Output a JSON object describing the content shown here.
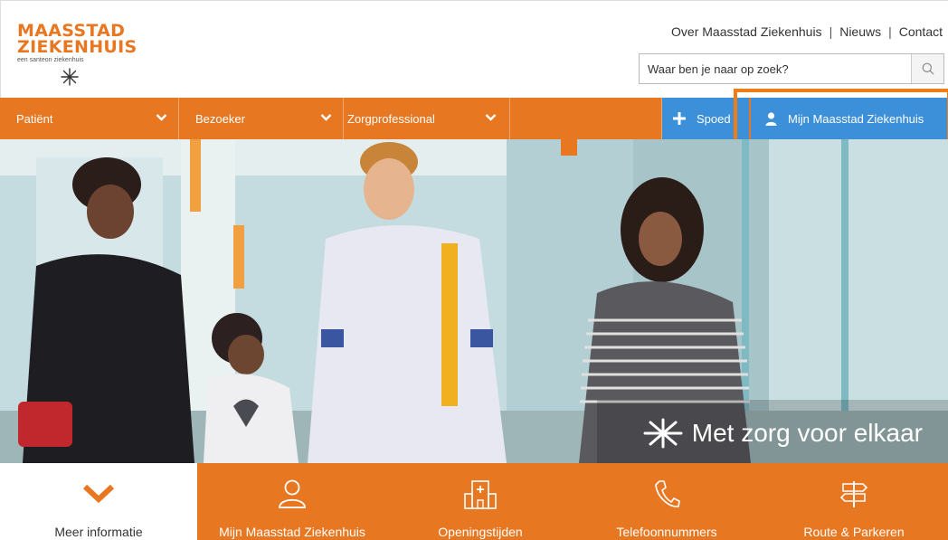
{
  "logo": {
    "line1": "MAASSTAD",
    "line2": "ZIEKENHUIS",
    "subtitle": "een santeon ziekenhuis"
  },
  "toplinks": {
    "items": [
      "Over Maasstad Ziekenhuis",
      "Nieuws",
      "Contact"
    ],
    "separator": "|"
  },
  "search": {
    "placeholder": "Waar ben je naar op zoek?"
  },
  "nav": {
    "items": [
      {
        "label": "Patiënt"
      },
      {
        "label": "Bezoeker"
      },
      {
        "label": "Zorgprofessional"
      }
    ],
    "spoed_label": "Spoed",
    "mijn_label": "Mijn Maasstad Ziekenhuis"
  },
  "hero": {
    "caption": "Met zorg voor elkaar"
  },
  "bottom": {
    "tiles": [
      {
        "label": "Meer informatie",
        "icon": "chevron-down-icon"
      },
      {
        "label": "Mijn Maasstad Ziekenhuis",
        "icon": "user-icon"
      },
      {
        "label": "Openingstijden",
        "icon": "clinic-icon"
      },
      {
        "label": "Telefoonnummers",
        "icon": "phone-icon"
      },
      {
        "label": "Route & Parkeren",
        "icon": "signpost-icon"
      }
    ]
  },
  "colors": {
    "brand_orange": "#e87722",
    "accent_blue": "#3c8fd9",
    "highlight_orange": "#f07c15"
  }
}
